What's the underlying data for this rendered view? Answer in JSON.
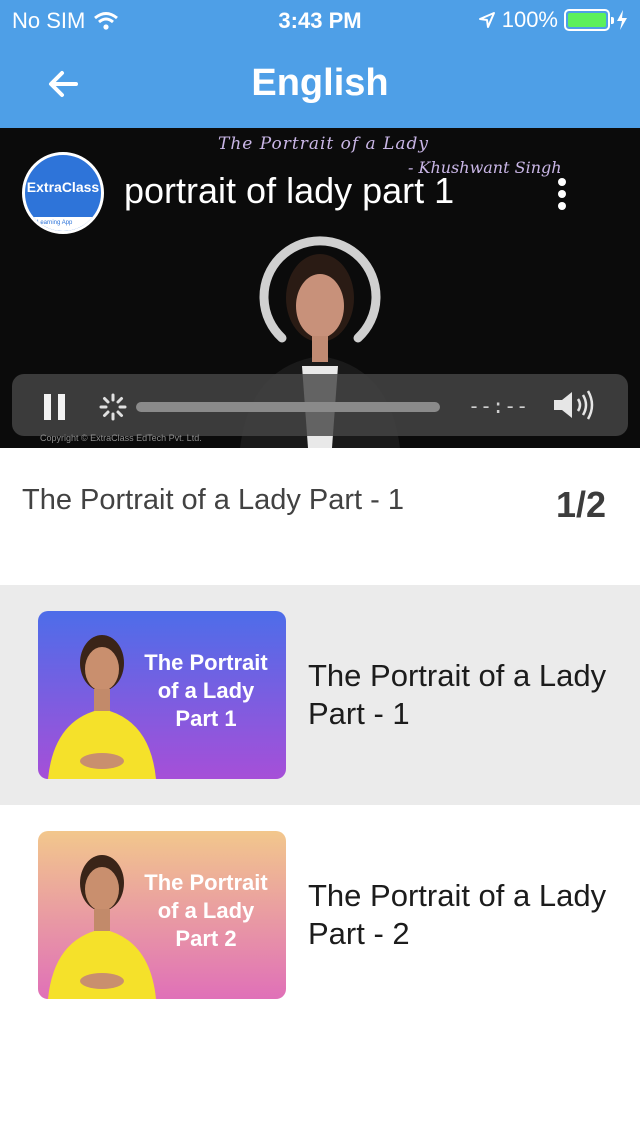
{
  "status_bar": {
    "carrier": "No SIM",
    "time": "3:43 PM",
    "battery": "100%",
    "battery_level": 1.0
  },
  "nav": {
    "title": "English",
    "back_icon": "arrow-left-icon"
  },
  "player": {
    "board_title": "The Portrait of a Lady",
    "board_author": "- Khushwant Singh",
    "logo_text": "ExtraClass",
    "logo_tagline": "Learning App",
    "video_title": "portrait of lady part 1",
    "time_readout": "--:--",
    "copyright": "Copyright © ExtraClass EdTech Pvt. Ltd.",
    "progress": 0.0,
    "icons": [
      "pause-icon",
      "loading-icon",
      "volume-icon",
      "more-vertical-icon"
    ]
  },
  "episode": {
    "title": "The Portrait of a Lady Part - 1",
    "count": "1/2"
  },
  "lessons": [
    {
      "label": "The Portrait of a Lady Part - 1",
      "thumb_text_1": "The Portrait",
      "thumb_text_2": "of a Lady",
      "thumb_text_3": "Part 1",
      "selected": true
    },
    {
      "label": "The Portrait of a Lady Part - 2",
      "thumb_text_1": "The Portrait",
      "thumb_text_2": "of a Lady",
      "thumb_text_3": "Part 2",
      "selected": false
    }
  ],
  "colors": {
    "header": "#4e9fe7",
    "battery_fill": "#5cf05c",
    "thumb1_top": "#4d6de9",
    "thumb1_bottom": "#a64fd8",
    "thumb2_top": "#f2c78c",
    "thumb2_bottom": "#e070b8"
  }
}
